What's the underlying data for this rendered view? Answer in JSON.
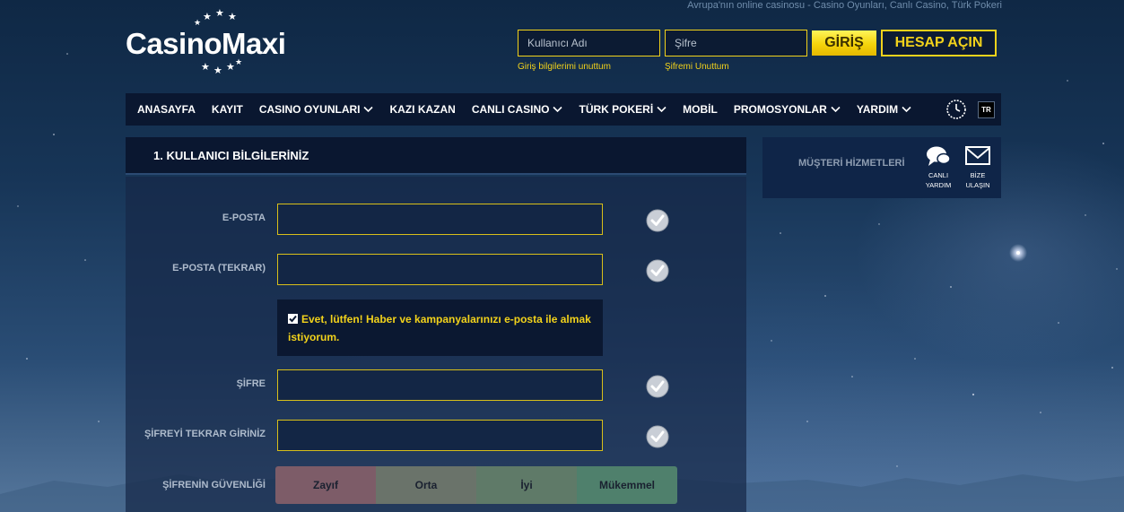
{
  "tagline": "Avrupa'nın online casinosu - Casino Oyunları, Canlı Casino, Türk Pokeri",
  "logo": {
    "text": "CasinoMaxi"
  },
  "login": {
    "username_placeholder": "Kullanıcı Adı",
    "password_placeholder": "Şifre",
    "forgot_credentials": "Giriş bilgilerimi unuttum",
    "forgot_password": "Şifremi Unuttum",
    "login_button": "GİRİŞ",
    "register_button": "HESAP AÇIN"
  },
  "nav": {
    "items": [
      {
        "label": "ANASAYFA",
        "dropdown": false
      },
      {
        "label": "KAYIT",
        "dropdown": false
      },
      {
        "label": "CASINO OYUNLARI",
        "dropdown": true
      },
      {
        "label": "KAZI KAZAN",
        "dropdown": false
      },
      {
        "label": "CANLI CASINO",
        "dropdown": true
      },
      {
        "label": "TÜRK POKERİ",
        "dropdown": true
      },
      {
        "label": "MOBİL",
        "dropdown": false
      },
      {
        "label": "PROMOSYONLAR",
        "dropdown": true
      },
      {
        "label": "YARDIM",
        "dropdown": true
      }
    ],
    "language": "TR"
  },
  "form": {
    "section_title": "1. KULLANICI BİLGİLERİNİZ",
    "fields": {
      "email": "E-POSTA",
      "email_repeat": "E-POSTA (TEKRAR)",
      "password": "ŞİFRE",
      "password_repeat": "ŞİFREYİ TEKRAR GİRİNİZ",
      "password_strength": "ŞİFRENİN GÜVENLİĞİ"
    },
    "consent_text": "Evet, lütfen! Haber ve kampanyalarınızı e-posta ile almak istiyorum.",
    "consent_checked": true,
    "strength_levels": [
      "Zayıf",
      "Orta",
      "İyi",
      "Mükemmel"
    ]
  },
  "customer_service": {
    "title": "MÜŞTERİ HİZMETLERİ",
    "live_help": [
      "CANLI",
      "YARDIM"
    ],
    "contact": [
      "BİZE",
      "ULAŞIN"
    ]
  },
  "colors": {
    "accent": "#f2d21b",
    "nav_bg": "#0a1730",
    "strength_weak": "#7d5c68",
    "strength_medium": "#6a736a",
    "strength_good": "#5f7a68",
    "strength_excellent": "#4f806c"
  }
}
